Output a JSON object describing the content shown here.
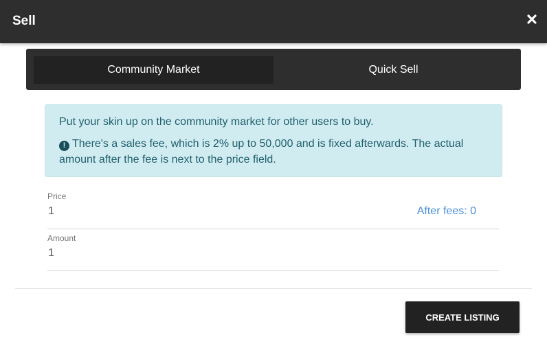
{
  "dialog": {
    "title": "Sell",
    "close_icon": "close-icon",
    "accent_color": "#2e2e2e"
  },
  "tabs": [
    {
      "label": "Community Market",
      "active": true
    },
    {
      "label": "Quick Sell",
      "active": false
    }
  ],
  "info": {
    "line1": "Put your skin up on the community market for other users to buy.",
    "line2": "There's a sales fee, which is 2% up to 50,000 and is fixed afterwards. The actual amount after the fee is next to the price field.",
    "icon": "exclamation-circle-icon",
    "icon_glyph": "!",
    "background_color": "#d1ecf1"
  },
  "form": {
    "price": {
      "label": "Price",
      "value": "1",
      "after_fees": "After fees: 0"
    },
    "amount": {
      "label": "Amount",
      "value": "1"
    }
  },
  "actions": {
    "create_label": "CREATE LISTING"
  }
}
